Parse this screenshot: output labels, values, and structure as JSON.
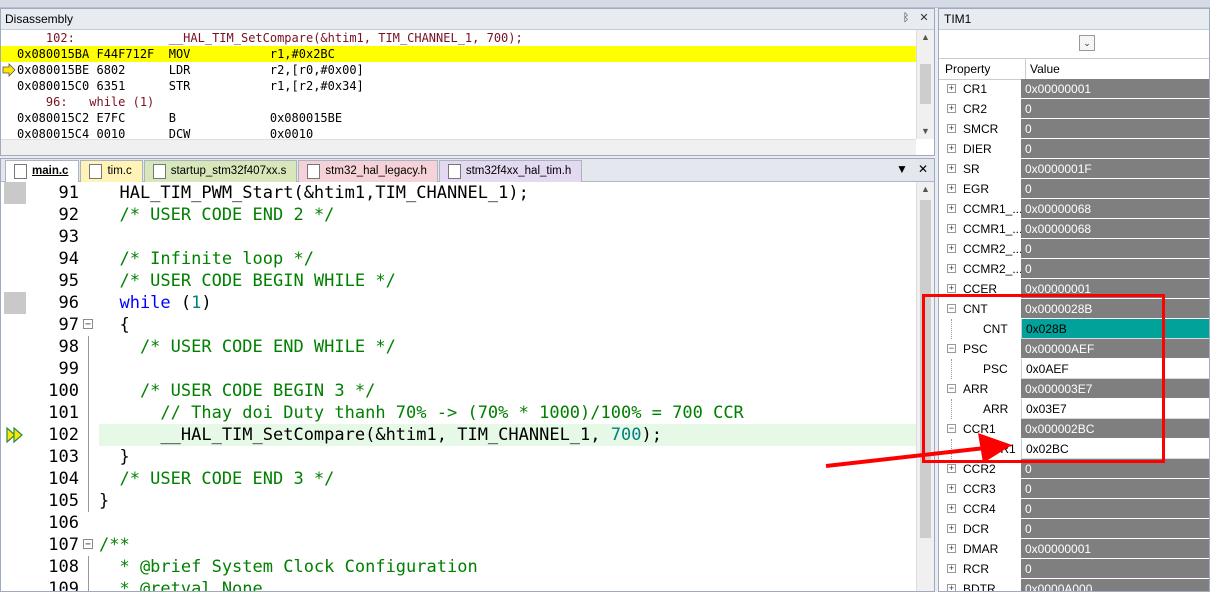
{
  "disassembly": {
    "title": "Disassembly",
    "lines": [
      {
        "text": "    102:             __HAL_TIM_SetCompare(&htim1, TIM_CHANNEL_1, 700);",
        "kind": "src"
      },
      {
        "text": "0x080015BA F44F712F  MOV           r1,#0x2BC",
        "kind": "hl"
      },
      {
        "text": "0x080015BE 6802      LDR           r2,[r0,#0x00]",
        "kind": "cur"
      },
      {
        "text": "0x080015C0 6351      STR           r1,[r2,#0x34]",
        "kind": "asm"
      },
      {
        "text": "    96:   while (1)",
        "kind": "src"
      },
      {
        "text": "0x080015C2 E7FC      B             0x080015BE",
        "kind": "asm"
      },
      {
        "text": "0x080015C4 0010      DCW           0x0010",
        "kind": "asm"
      }
    ]
  },
  "tabs": [
    {
      "label": "main.c",
      "color": "#ffffff",
      "active": true
    },
    {
      "label": "tim.c",
      "color": "#fff3b8",
      "active": false
    },
    {
      "label": "startup_stm32f407xx.s",
      "color": "#d7e7b9",
      "active": false
    },
    {
      "label": "stm32_hal_legacy.h",
      "color": "#f5d2d8",
      "active": false
    },
    {
      "label": "stm32f4xx_hal_tim.h",
      "color": "#e3d9f0",
      "active": false
    }
  ],
  "tab_controls": {
    "dropdown": "▼",
    "close": "✕"
  },
  "code": [
    {
      "n": "91",
      "mark": true,
      "fold": "",
      "parts": [
        [
          "pl",
          "  HAL_TIM_PWM_Start(&htim1,TIM_CHANNEL_1);"
        ]
      ]
    },
    {
      "n": "92",
      "mark": false,
      "fold": "",
      "parts": [
        [
          "cm",
          "  /* USER CODE END 2 */"
        ]
      ]
    },
    {
      "n": "93",
      "mark": false,
      "fold": "",
      "parts": [
        [
          "pl",
          " "
        ]
      ]
    },
    {
      "n": "94",
      "mark": false,
      "fold": "",
      "parts": [
        [
          "cm",
          "  /* Infinite loop */"
        ]
      ]
    },
    {
      "n": "95",
      "mark": false,
      "fold": "",
      "parts": [
        [
          "cm",
          "  /* USER CODE BEGIN WHILE */"
        ]
      ]
    },
    {
      "n": "96",
      "mark": true,
      "fold": "",
      "parts": [
        [
          "kw",
          "  while"
        ],
        [
          "pl",
          " ("
        ],
        [
          "nm",
          "1"
        ],
        [
          "pl",
          ")"
        ]
      ]
    },
    {
      "n": "97",
      "mark": false,
      "fold": "box",
      "parts": [
        [
          "pl",
          "  {"
        ]
      ]
    },
    {
      "n": "98",
      "mark": false,
      "fold": "line",
      "parts": [
        [
          "cm",
          "    /* USER CODE END WHILE */"
        ]
      ]
    },
    {
      "n": "99",
      "mark": false,
      "fold": "line",
      "parts": [
        [
          "pl",
          " "
        ]
      ]
    },
    {
      "n": "100",
      "mark": false,
      "fold": "line",
      "parts": [
        [
          "cm",
          "    /* USER CODE BEGIN 3 */"
        ]
      ]
    },
    {
      "n": "101",
      "mark": false,
      "fold": "line",
      "parts": [
        [
          "cm",
          "      // Thay doi Duty thanh 70% -> (70% * 1000)/100% = 700 CCR"
        ]
      ]
    },
    {
      "n": "102",
      "mark": "exec",
      "fold": "line",
      "current": true,
      "parts": [
        [
          "pl",
          "      __HAL_TIM_SetCompare(&htim1, TIM_CHANNEL_1, "
        ],
        [
          "nm",
          "700"
        ],
        [
          "pl",
          ");"
        ]
      ]
    },
    {
      "n": "103",
      "mark": false,
      "fold": "line",
      "parts": [
        [
          "pl",
          "  }"
        ]
      ]
    },
    {
      "n": "104",
      "mark": false,
      "fold": "line",
      "parts": [
        [
          "cm",
          "  /* USER CODE END 3 */"
        ]
      ]
    },
    {
      "n": "105",
      "mark": false,
      "fold": "line",
      "parts": [
        [
          "pl",
          "}"
        ]
      ]
    },
    {
      "n": "106",
      "mark": false,
      "fold": "",
      "parts": [
        [
          "pl",
          " "
        ]
      ]
    },
    {
      "n": "107",
      "mark": false,
      "fold": "box",
      "parts": [
        [
          "cm",
          "/**"
        ]
      ]
    },
    {
      "n": "108",
      "mark": false,
      "fold": "line",
      "parts": [
        [
          "cm",
          "  * @brief System Clock Configuration"
        ]
      ]
    },
    {
      "n": "109",
      "mark": false,
      "fold": "line",
      "parts": [
        [
          "cm",
          "  * @retval None"
        ]
      ]
    }
  ],
  "peripheral": {
    "title": "TIM1",
    "dropdown_glyph": "⌄",
    "col_property": "Property",
    "col_value": "0x Value",
    "col_property_label": "Property",
    "col_value_label": "Value",
    "rows": [
      {
        "name": "CR1",
        "value": "0x00000001",
        "exp": "+",
        "child": false
      },
      {
        "name": "CR2",
        "value": "0",
        "exp": "+",
        "child": false
      },
      {
        "name": "SMCR",
        "value": "0",
        "exp": "+",
        "child": false
      },
      {
        "name": "DIER",
        "value": "0",
        "exp": "+",
        "child": false
      },
      {
        "name": "SR",
        "value": "0x0000001F",
        "exp": "+",
        "child": false
      },
      {
        "name": "EGR",
        "value": "0",
        "exp": "+",
        "child": false
      },
      {
        "name": "CCMR1_...",
        "value": "0x00000068",
        "exp": "+",
        "child": false
      },
      {
        "name": "CCMR1_...",
        "value": "0x00000068",
        "exp": "+",
        "child": false
      },
      {
        "name": "CCMR2_...",
        "value": "0",
        "exp": "+",
        "child": false
      },
      {
        "name": "CCMR2_...",
        "value": "0",
        "exp": "+",
        "child": false
      },
      {
        "name": "CCER",
        "value": "0x00000001",
        "exp": "+",
        "child": false
      },
      {
        "name": "CNT",
        "value": "0x0000028B",
        "exp": "−",
        "child": false
      },
      {
        "name": "CNT",
        "value": "0x028B",
        "exp": "",
        "child": true,
        "teal": true
      },
      {
        "name": "PSC",
        "value": "0x00000AEF",
        "exp": "−",
        "child": false
      },
      {
        "name": "PSC",
        "value": "0x0AEF",
        "exp": "",
        "child": true
      },
      {
        "name": "ARR",
        "value": "0x000003E7",
        "exp": "−",
        "child": false
      },
      {
        "name": "ARR",
        "value": "0x03E7",
        "exp": "",
        "child": true
      },
      {
        "name": "CCR1",
        "value": "0x000002BC",
        "exp": "−",
        "child": false
      },
      {
        "name": "CCR1",
        "value": "0x02BC",
        "exp": "",
        "child": true
      },
      {
        "name": "CCR2",
        "value": "0",
        "exp": "+",
        "child": false
      },
      {
        "name": "CCR3",
        "value": "0",
        "exp": "+",
        "child": false
      },
      {
        "name": "CCR4",
        "value": "0",
        "exp": "+",
        "child": false
      },
      {
        "name": "DCR",
        "value": "0",
        "exp": "+",
        "child": false
      },
      {
        "name": "DMAR",
        "value": "0x00000001",
        "exp": "+",
        "child": false
      },
      {
        "name": "RCR",
        "value": "0",
        "exp": "+",
        "child": false
      },
      {
        "name": "BDTR",
        "value": "0x0000A000",
        "exp": "+",
        "child": false
      }
    ]
  },
  "colors": {
    "highlight": "#ffff00",
    "teal": "#00a29a",
    "annotation": "#ff0000"
  }
}
